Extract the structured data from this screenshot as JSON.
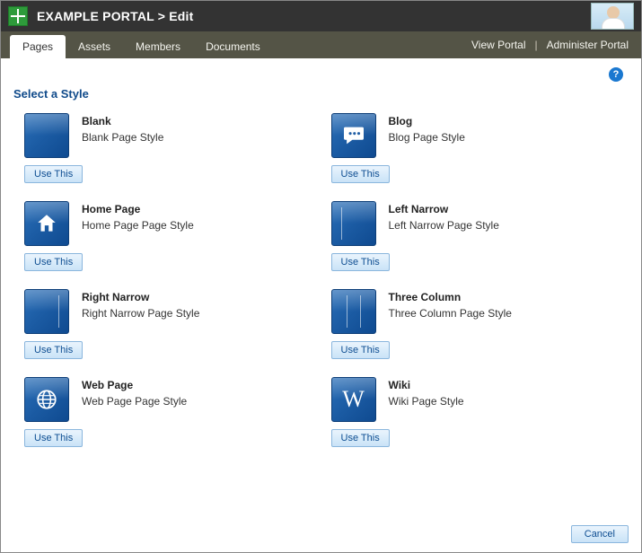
{
  "header": {
    "portal_name": "EXAMPLE PORTAL",
    "breadcrumb_sep": ">",
    "page_mode": "Edit"
  },
  "nav": {
    "tabs": [
      {
        "label": "Pages",
        "active": true
      },
      {
        "label": "Assets",
        "active": false
      },
      {
        "label": "Members",
        "active": false
      },
      {
        "label": "Documents",
        "active": false
      }
    ],
    "view_portal": "View Portal",
    "admin_portal": "Administer Portal"
  },
  "section_title": "Select a Style",
  "use_this_label": "Use This",
  "cancel_label": "Cancel",
  "styles": [
    {
      "id": "blank",
      "title": "Blank",
      "desc": "Blank Page Style",
      "icon": "blank"
    },
    {
      "id": "blog",
      "title": "Blog",
      "desc": "Blog Page Style",
      "icon": "blog"
    },
    {
      "id": "home",
      "title": "Home Page",
      "desc": "Home Page Page Style",
      "icon": "home"
    },
    {
      "id": "left-narrow",
      "title": "Left Narrow",
      "desc": "Left Narrow Page Style",
      "icon": "leftn"
    },
    {
      "id": "right-narrow",
      "title": "Right Narrow",
      "desc": "Right Narrow Page Style",
      "icon": "rightn"
    },
    {
      "id": "three-column",
      "title": "Three Column",
      "desc": "Three Column Page Style",
      "icon": "threec"
    },
    {
      "id": "web-page",
      "title": "Web Page",
      "desc": "Web Page Page Style",
      "icon": "web"
    },
    {
      "id": "wiki",
      "title": "Wiki",
      "desc": "Wiki Page Style",
      "icon": "wiki"
    }
  ]
}
